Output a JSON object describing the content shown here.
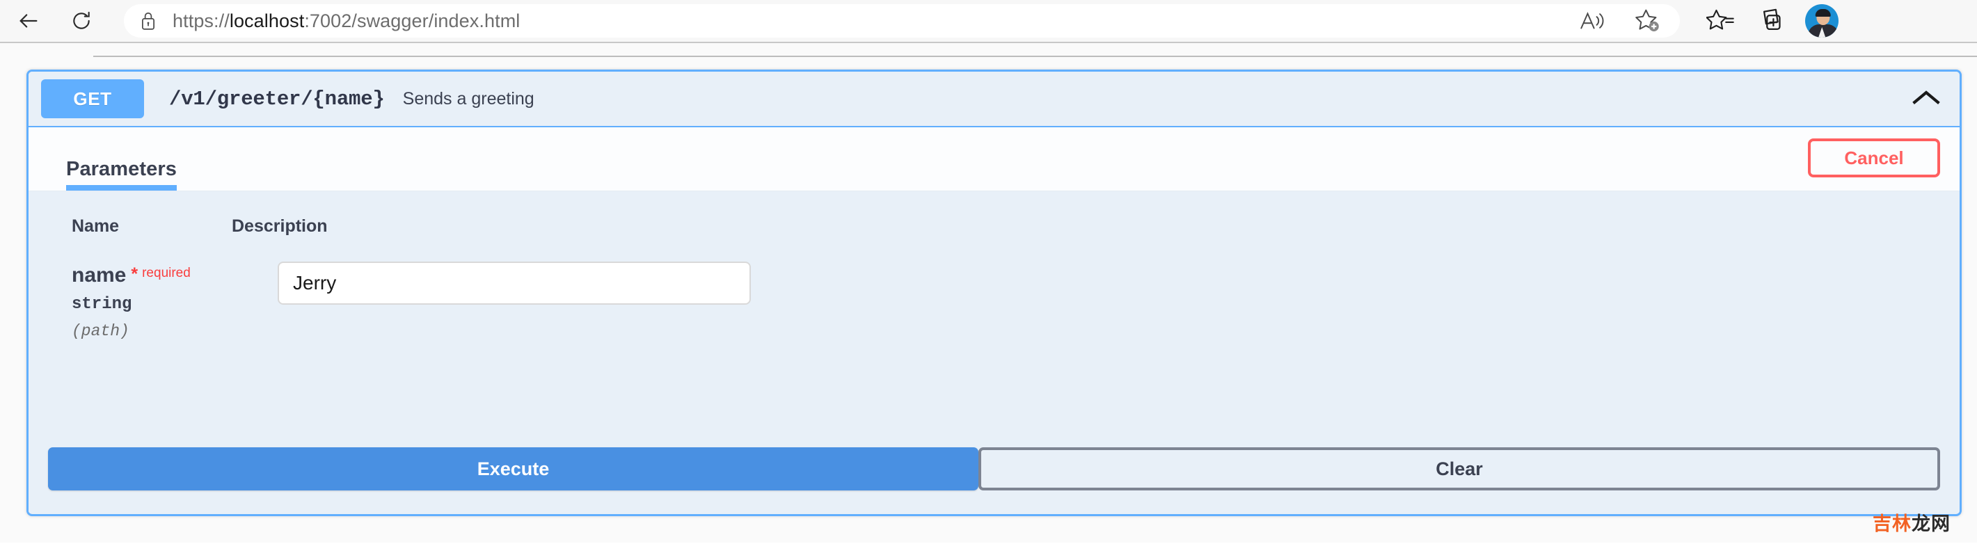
{
  "browser": {
    "back_icon": "arrow-left-icon",
    "reload_icon": "reload-icon",
    "lock_icon": "lock-icon",
    "url_scheme": "https://",
    "url_domain": "localhost",
    "url_rest": ":7002/swagger/index.html",
    "url_full": "https://localhost:7002/swagger/index.html",
    "right_icons": [
      {
        "name": "read-aloud-icon",
        "label": "Read aloud"
      },
      {
        "name": "add-favorite-icon",
        "label": "Add this page to favorites"
      },
      {
        "name": "favorites-icon",
        "label": "Favorites"
      },
      {
        "name": "collections-icon",
        "label": "Collections"
      }
    ],
    "avatar_label": "Profile"
  },
  "operation": {
    "method": "GET",
    "path": "/v1/greeter/{name}",
    "description": "Sends a greeting",
    "collapse_icon": "chevron-up-icon",
    "accent_color": "#61affe"
  },
  "params_panel": {
    "tab_label": "Parameters",
    "cancel_label": "Cancel",
    "cancel_color": "#ff6060",
    "columns": {
      "name": "Name",
      "description": "Description"
    },
    "rows": [
      {
        "name": "name",
        "required_marker": "*",
        "required_label": "required",
        "type": "string",
        "location": "(path)",
        "value": "Jerry",
        "placeholder": "name"
      }
    ]
  },
  "actions": {
    "execute_label": "Execute",
    "execute_color": "#4990e2",
    "clear_label": "Clear"
  },
  "watermark": {
    "part1": "吉林",
    "part2": "龙网"
  }
}
